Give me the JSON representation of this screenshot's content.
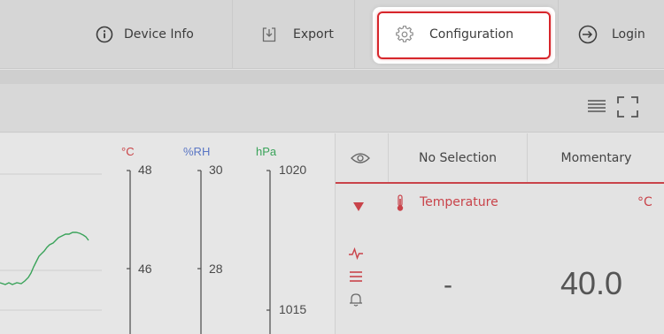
{
  "nav": {
    "device_info": "Device Info",
    "export": "Export",
    "configuration": "Configuration",
    "login": "Login"
  },
  "chart": {
    "units": {
      "temp": "°C",
      "humidity": "%RH",
      "pressure": "hPa"
    },
    "temp_ticks": [
      "48",
      "46"
    ],
    "humidity_ticks": [
      "30",
      "28"
    ],
    "pressure_ticks": [
      "1020",
      "1015"
    ],
    "colors": {
      "temp": "#c94246",
      "humidity": "#5a76c4",
      "pressure": "#3aa35a"
    },
    "line_color": "#3aa35a"
  },
  "panel": {
    "header_selection": "No Selection",
    "header_mode": "Momentary",
    "sensor_label": "Temperature",
    "sensor_unit": "°C",
    "selection_value": "-",
    "momentary_value": "40.0",
    "accent": "#c9434a"
  }
}
